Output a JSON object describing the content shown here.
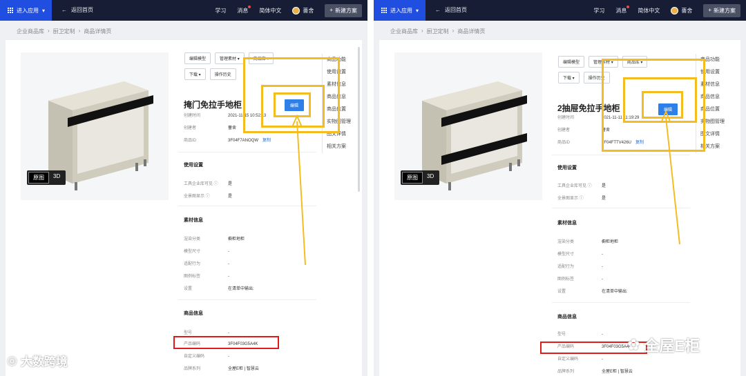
{
  "topbar": {
    "app_label": "进入应用",
    "back_label": "返回首页",
    "menu": [
      "学习",
      "消息",
      "简体中文"
    ],
    "user": "薔舍",
    "new_label": "新建方案"
  },
  "breadcrumb": [
    "企业商品库",
    "厨卫定制",
    "商品详情页"
  ],
  "view_toggle": [
    "原图",
    "3D"
  ],
  "toolbar": {
    "edit_model": "编辑模型",
    "manage_material": "管理素材",
    "product_kind": "商品库",
    "download": "下载",
    "history": "操作历史",
    "edit": "编辑"
  },
  "labels": {
    "created_time": "创建时间",
    "creator": "创建者",
    "product_id": "商品ID",
    "copy": "复制",
    "usage": "使用设置",
    "tool_visible": "工具企业库可见",
    "panorama": "全景图显示",
    "material_info": "素材信息",
    "render_cat": "渲染分类",
    "model_size": "模型尺寸",
    "adapt": "适配行为",
    "legend": "图例标签",
    "setting": "设置",
    "product_info": "商品信息",
    "model_no": "型号",
    "product_code": "产品编码",
    "custom_code": "自定义编码",
    "brand": "品牌系列"
  },
  "side_nav": [
    "商品功能",
    "使用设置",
    "素材信息",
    "商品信息",
    "商品位置",
    "实物图管理",
    "图文详情",
    "相关方案"
  ],
  "left": {
    "title": "掩门免拉手地柜",
    "created_time": "2021-11-15 10:52:13",
    "creator": "薔舍",
    "product_id": "3F04F7ANOQW",
    "tool_visible": "是",
    "panorama": "是",
    "render_cat": "橱柜地柜",
    "model_size": "-",
    "adapt": "-",
    "legend": "-",
    "setting": "在清单中输出:",
    "model_no": "-",
    "product_code": "3F04F03G5A4K",
    "custom_code": "-",
    "brand": "全屋E柜 | 智慧云"
  },
  "right": {
    "title": "2抽屉免拉手地柜",
    "created_time": "2021-11-11 11:19:29",
    "creator": "薔舍",
    "product_id": "3F04FTTV426U",
    "tool_visible": "是",
    "panorama": "是",
    "render_cat": "橱柜地柜",
    "model_size": "-",
    "adapt": "-",
    "legend": "-",
    "setting": "在清单中输出:",
    "model_no": "-",
    "product_code": "3F04F03G5A4K",
    "custom_code": "-",
    "brand": "全屋E柜 | 智慧云"
  },
  "watermarks": {
    "left": "大数跨境",
    "right": "全屋E柜"
  },
  "colors": {
    "topbar": "#161d35",
    "accent_blue": "#1f4ee0",
    "edit_blue": "#2f7fe8",
    "highlight_yellow": "#f3bd22",
    "highlight_red": "#e01919"
  }
}
